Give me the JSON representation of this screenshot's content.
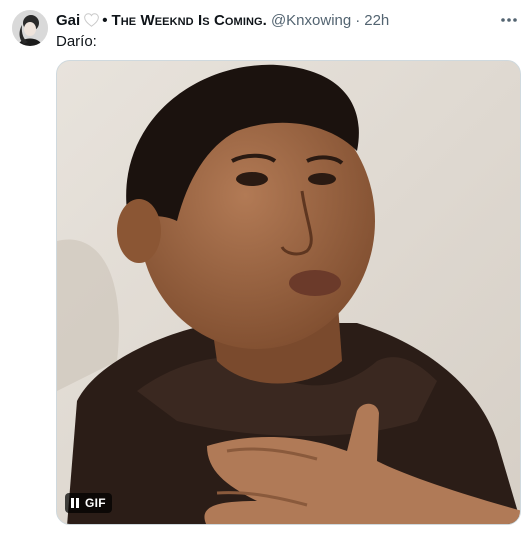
{
  "tweet": {
    "author_name": "Gai",
    "separator_bullet": "•",
    "display_name": "The Weeknd Is Coming.",
    "handle": "@Knxowing",
    "time_separator": "·",
    "timestamp": "22h",
    "text": "Darío:",
    "media": {
      "badge_label": "GIF"
    }
  },
  "colors": {
    "text_primary": "#0f1419",
    "text_secondary": "#536471",
    "border": "#cfd9de"
  },
  "icons": {
    "heart": "white-heart-icon",
    "more": "more-horizontal-icon",
    "pause": "pause-icon"
  }
}
